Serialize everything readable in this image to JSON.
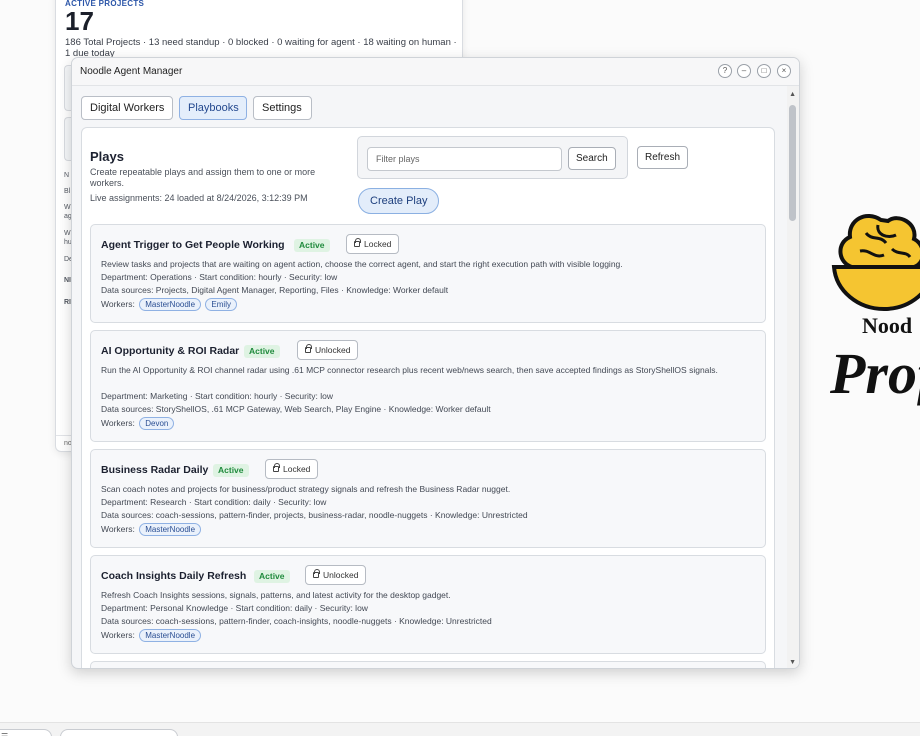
{
  "background_window": {
    "label": "ACTIVE PROJECTS",
    "count": "17",
    "summary": "186 Total Projects · 13 need standup · 0 blocked · 0 waiting for agent · 18 waiting on human · 1 due today",
    "side_letters": [
      "N",
      "Bl",
      "W",
      "ag",
      "W",
      "hu",
      "De",
      "NI",
      "RI"
    ],
    "footer": "no"
  },
  "logo": {
    "text_top": "Nood",
    "text_script": "Prof"
  },
  "taskbar": {
    "item1": "☰ ...",
    "item2": "..."
  },
  "window": {
    "title": "Noodle Agent Manager",
    "controls": {
      "help": "?",
      "minimize": "–",
      "maximize": "□",
      "close": "×"
    },
    "tabs": [
      {
        "label": "Digital Workers"
      },
      {
        "label": "Playbooks"
      },
      {
        "label": "Settings"
      }
    ]
  },
  "plays": {
    "title": "Plays",
    "description": "Create repeatable plays and assign them to one or more workers.",
    "live": "Live assignments: 24 loaded at 8/24/2026, 3:12:39 PM",
    "filter_placeholder": "Filter plays",
    "search_label": "Search",
    "refresh_label": "Refresh",
    "create_label": "Create Play"
  },
  "cards": [
    {
      "title": "Agent Trigger to Get People Working",
      "status": "Active",
      "lock": "Locked",
      "summary": "Review tasks and projects that are waiting on agent action, choose the correct agent, and start the right execution path with visible logging.",
      "meta": "Department: Operations · Start condition: hourly · Security: low",
      "sources": "Data sources: Projects, Digital Agent Manager, Reporting, Files · Knowledge: Worker default",
      "workers_label": "Workers:",
      "workers": [
        "MasterNoodle",
        "Emily"
      ]
    },
    {
      "title": "AI Opportunity & ROI Radar",
      "status": "Active",
      "lock": "Unlocked",
      "summary": "Run the AI Opportunity & ROI channel radar using .61 MCP connector research plus recent web/news search, then save accepted findings as StoryShellOS signals.",
      "meta": "Department: Marketing · Start condition: hourly · Security: low",
      "sources": "Data sources: StoryShellOS, .61 MCP Gateway, Web Search, Play Engine · Knowledge: Worker default",
      "workers_label": "Workers:",
      "workers": [
        "Devon"
      ]
    },
    {
      "title": "Business Radar Daily",
      "status": "Active",
      "lock": "Locked",
      "summary": "Scan coach notes and projects for business/product strategy signals and refresh the Business Radar nugget.",
      "meta": "Department: Research · Start condition: daily · Security: low",
      "sources": "Data sources: coach-sessions, pattern-finder, projects, business-radar, noodle-nuggets · Knowledge: Unrestricted",
      "workers_label": "Workers:",
      "workers": [
        "MasterNoodle"
      ]
    },
    {
      "title": "Coach Insights Daily Refresh",
      "status": "Active",
      "lock": "Unlocked",
      "summary": "Refresh Coach Insights sessions, signals, patterns, and latest activity for the desktop gadget.",
      "meta": "Department: Personal Knowledge · Start condition: daily · Security: low",
      "sources": "Data sources: coach-sessions, pattern-finder, coach-insights, noodle-nuggets · Knowledge: Unrestricted",
      "workers_label": "Workers:",
      "workers": [
        "MasterNoodle"
      ]
    }
  ]
}
